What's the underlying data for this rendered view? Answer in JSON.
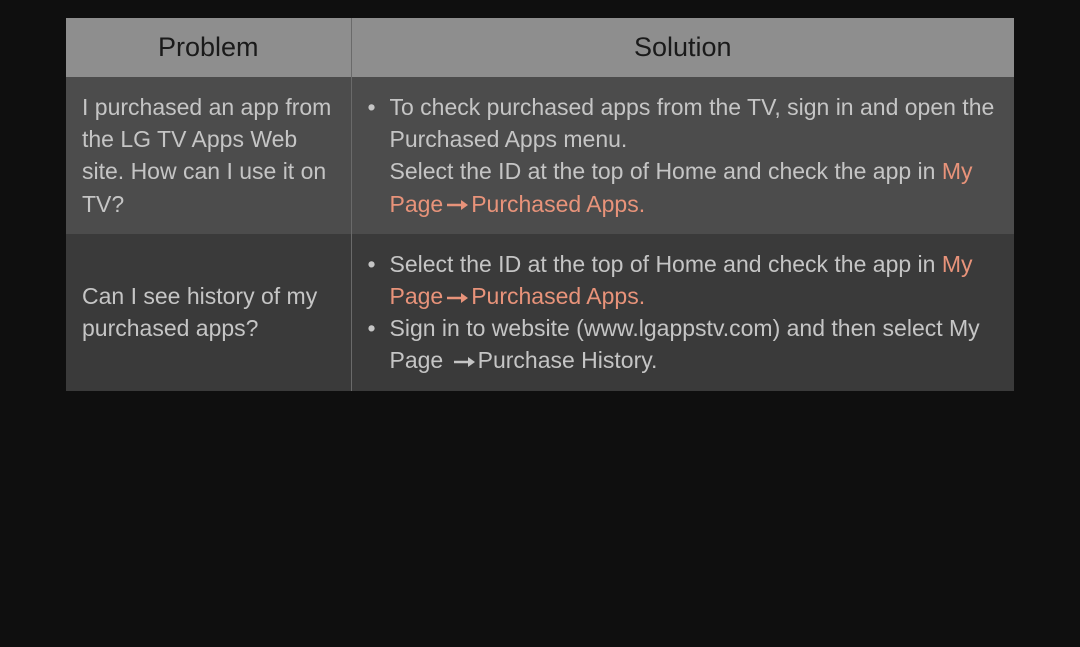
{
  "table": {
    "headers": {
      "problem": "Problem",
      "solution": "Solution"
    },
    "rows": [
      {
        "problem": "I purchased an app from the LG TV Apps Web site. How can I use it on TV?",
        "solution": {
          "bullets": [
            {
              "line1": "To check purchased apps from the TV, sign in and open the Purchased Apps menu.",
              "line2_prefix": "Select the ID at the top of Home and check the app in ",
              "nav_from": "My Page",
              "nav_to": "Purchased Apps",
              "nav_suffix": "."
            }
          ]
        }
      },
      {
        "problem": "Can I see history of my purchased apps?",
        "solution": {
          "bullets": [
            {
              "line1_prefix": "Select the ID at the top of Home and check the app in ",
              "nav_from": "My Page",
              "nav_to": "Purchased Apps",
              "nav_suffix": "."
            },
            {
              "line1_prefix": "Sign in to website (www.lgappstv.com) and then select My Page ",
              "nav_to_plain": "Purchase History",
              "nav_suffix": "."
            }
          ]
        }
      }
    ]
  }
}
